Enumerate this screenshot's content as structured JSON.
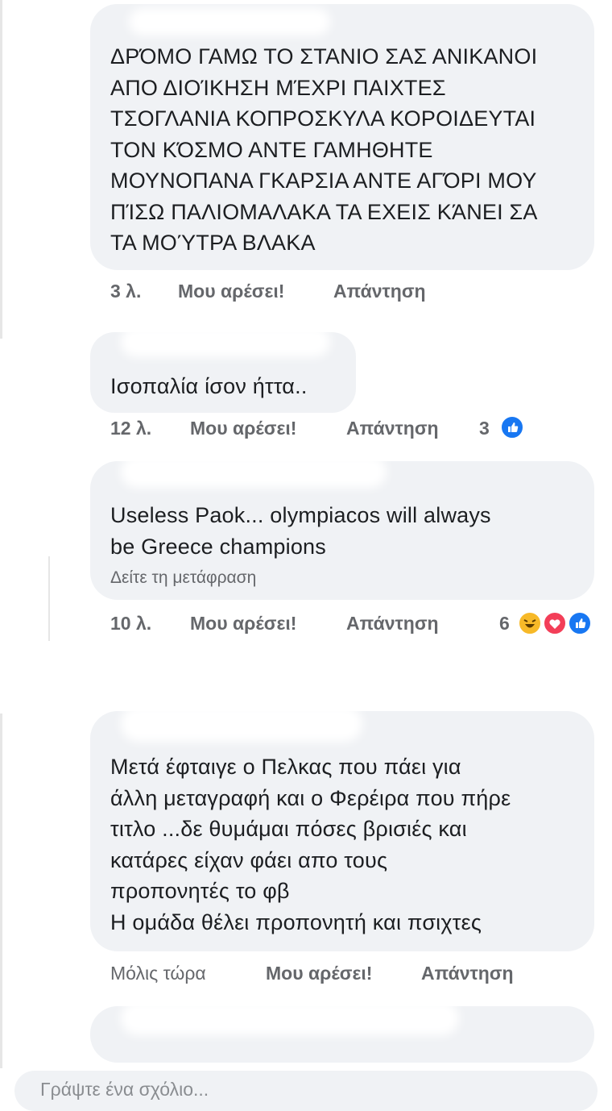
{
  "comments": [
    {
      "text": "ΔΡΌΜΟ ΓΑΜΩ ΤΟ ΣΤΑΝΙΟ ΣΑΣ ΑΝΙΚΑΝΟΙ\nΑΠΟ ΔΙΟΊΚΗΣΗ ΜΈΧΡΙ ΠΑΙΧΤΕΣ\nΤΣΟΓΛΑΝΙΑ ΚΟΠΡΟΣΚΥΛΑ ΚΟΡΟΙΔΕΥΤΑΙ\nΤΟΝ ΚΌΣΜΟ ΑΝΤΕ ΓΑΜΗΘΗΤΕ\nΜΟΥΝΟΠΑΝΑ ΓΚΑΡΣΙΑ ΑΝΤΕ ΑΓΌΡΙ ΜΟΥ\nΠΊΣΩ ΠΑΛΙΟΜΑΛΑΚΑ ΤΑ ΕΧΕΙΣ ΚΆΝΕΙ ΣΑ\nΤΑ ΜΟΎΤΡΑ ΒΛΑΚΑ",
      "time": "3 λ.",
      "like": "Μου αρέσει!",
      "reply": "Απάντηση"
    },
    {
      "text": "Ισοπαλία ίσον ήττα..",
      "time": "12 λ.",
      "like": "Μου αρέσει!",
      "reply": "Απάντηση",
      "reactions": "3"
    },
    {
      "text": "Useless Paok... olympiacos will always\nbe Greece champions",
      "translate": "Δείτε τη μετάφραση",
      "time": "10 λ.",
      "like": "Μου αρέσει!",
      "reply": "Απάντηση",
      "reactions": "6"
    },
    {
      "text": "Μετά έφταιγε ο Πελκας που πάει για\nάλλη μεταγραφή και ο Φερέιρα που πήρε\nτιτλο ...δε θυμάμαι πόσες  βρισιές και\nκατάρες είχαν φάει απο τους\nπροπονητές το φβ\nΗ ομάδα θέλει προπονητή και πσιχτες",
      "time": "Μόλις τώρα",
      "like": "Μου αρέσει!",
      "reply": "Απάντηση"
    }
  ],
  "composer": {
    "placeholder": "Γράψτε ένα σχόλιο..."
  },
  "colors": {
    "bubble": "#f0f2f5",
    "meta": "#65676b",
    "like": "#1877f2",
    "love": "#f33e58",
    "haha": "#f7b928"
  }
}
